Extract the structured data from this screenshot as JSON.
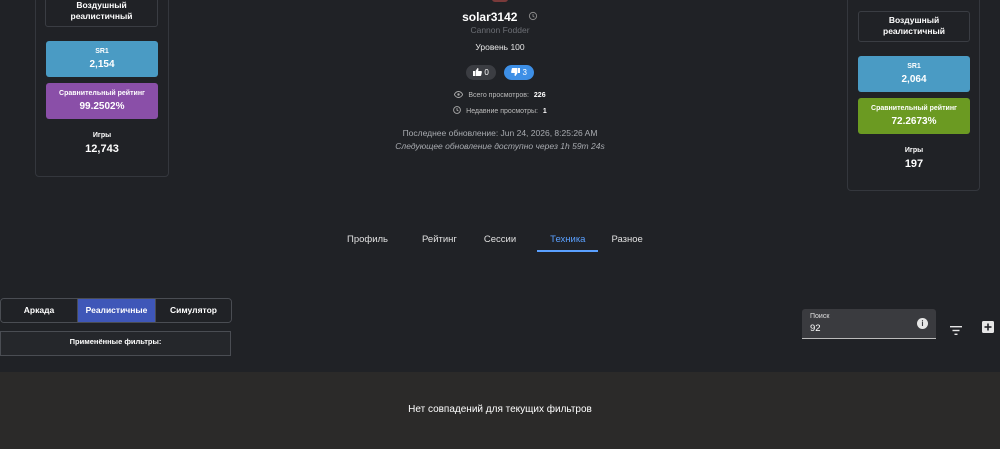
{
  "left_card": {
    "mode_label": "Воздушный реалистичный",
    "sr1": {
      "label": "SR1",
      "value": "2,154"
    },
    "rating": {
      "label": "Сравнительный рейтинг",
      "value": "99.2502%"
    },
    "games": {
      "label": "Игры",
      "value": "12,743"
    }
  },
  "right_card": {
    "mode_label": "Воздушный реалистичный",
    "sr1": {
      "label": "SR1",
      "value": "2,064"
    },
    "rating": {
      "label": "Сравнительный рейтинг",
      "value": "72.2673%"
    },
    "games": {
      "label": "Игры",
      "value": "197"
    }
  },
  "profile": {
    "username": "solar3142",
    "title": "Cannon Fodder",
    "level": "Уровень 100",
    "likes": "0",
    "dislikes": "3",
    "total_views_label": "Всего просмотров:",
    "total_views": "226",
    "recent_views_label": "Недавние просмотры:",
    "recent_views": "1",
    "last_update": "Последнее обновление: Jun 24, 2026, 8:25:26 AM",
    "next_update": "Следующее обновление доступно через 1h 59m 24s"
  },
  "tabs": [
    {
      "label": "Профиль"
    },
    {
      "label": "Рейтинг"
    },
    {
      "label": "Сессии"
    },
    {
      "label": "Техника"
    },
    {
      "label": "Разное"
    }
  ],
  "modes": [
    {
      "label": "Аркада"
    },
    {
      "label": "Реалистичные"
    },
    {
      "label": "Симулятор"
    }
  ],
  "filters_label": "Применённые фильтры:",
  "search": {
    "label": "Поиск",
    "value": "92"
  },
  "empty_message": "Нет совпадений для текущих фильтров",
  "colors": {
    "sr1": "#4a9bc4",
    "rating_left": "#8a4fa8",
    "rating_right": "#6b9a22",
    "active_mode": "#3f57b8",
    "accent": "#5aa0ff",
    "dislike_pill": "#3d8fe6"
  },
  "icons": [
    "history-icon",
    "thumb-up-icon",
    "thumb-down-icon",
    "eye-icon",
    "clock-icon",
    "info-icon",
    "filter-icon",
    "add-box-icon"
  ]
}
